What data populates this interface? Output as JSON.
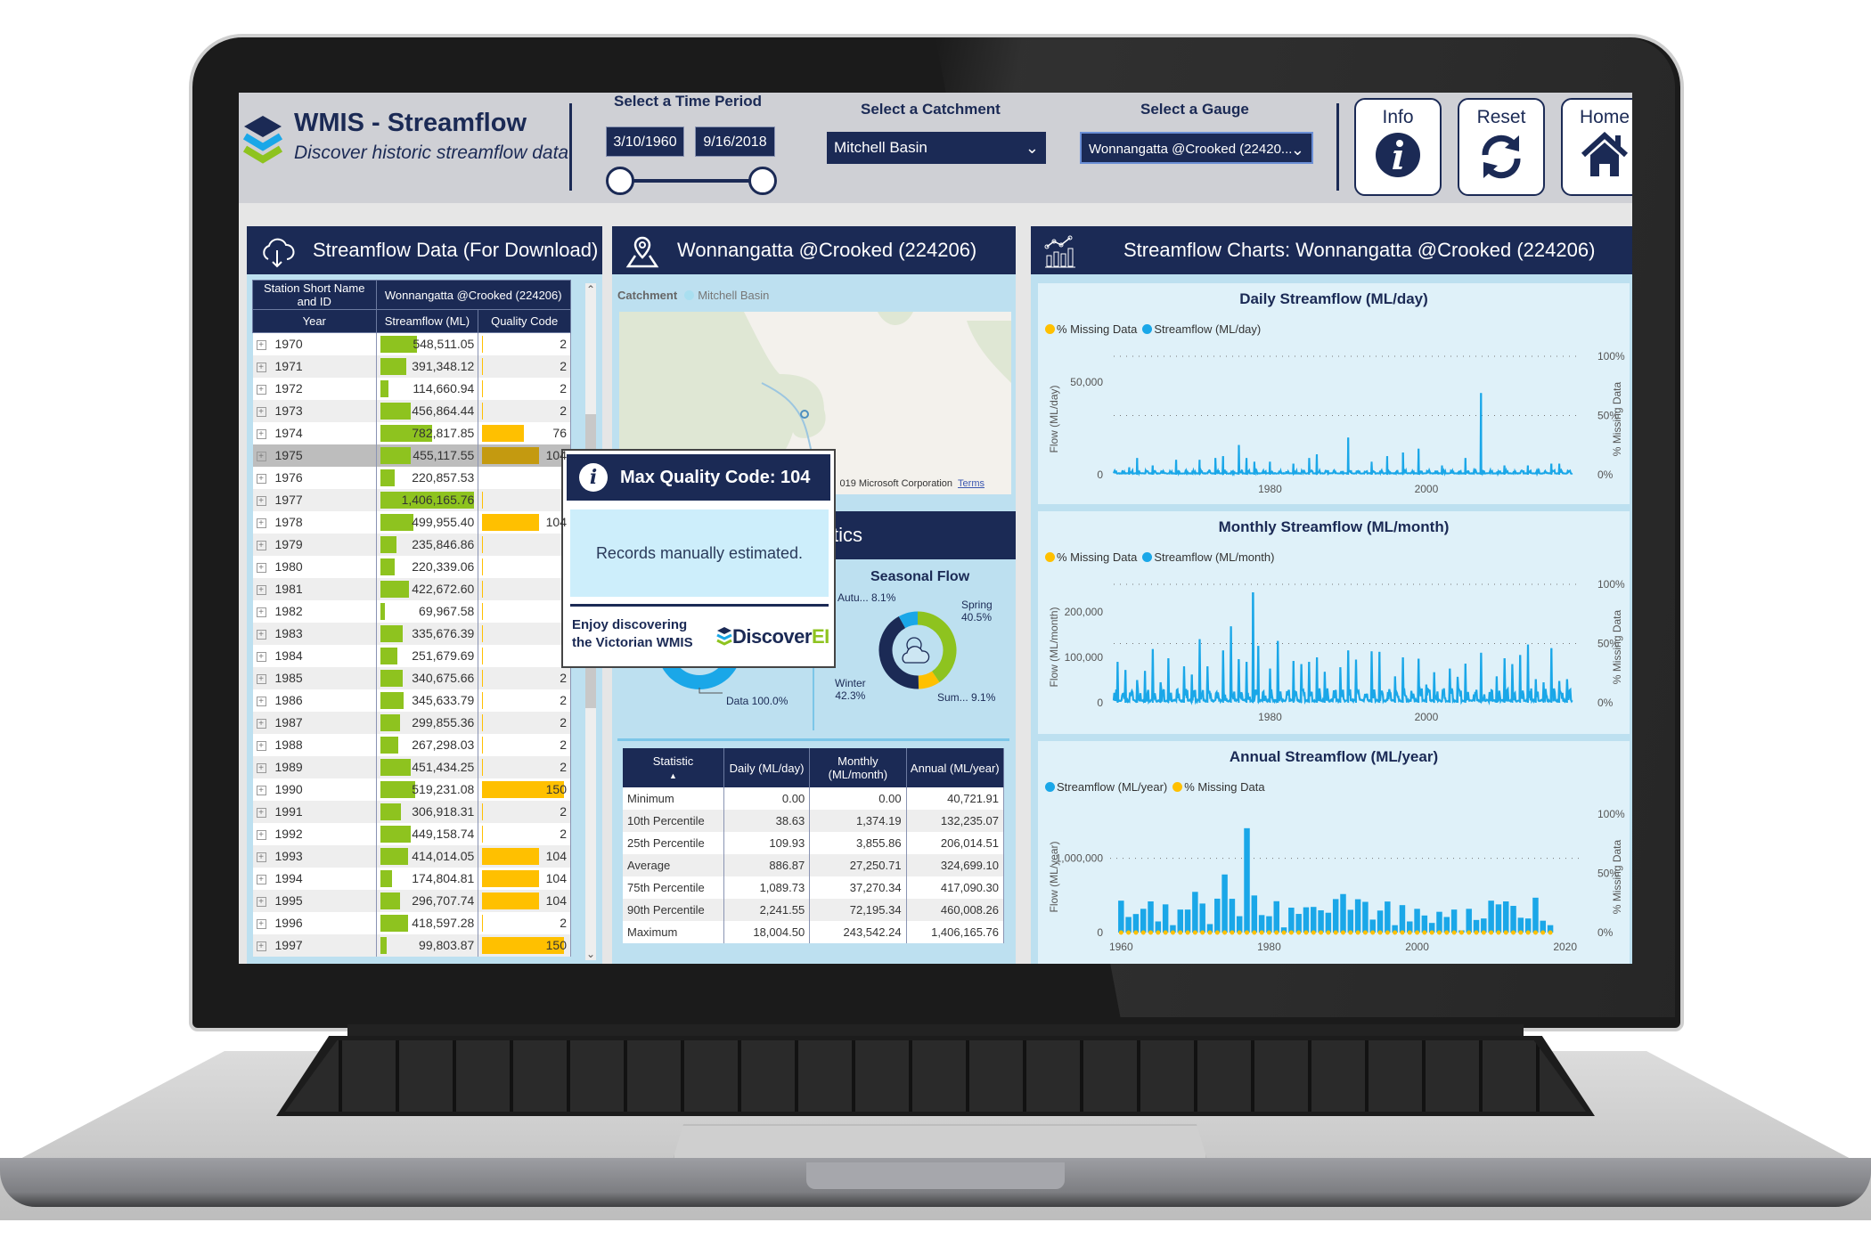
{
  "header": {
    "title": "WMIS - Streamflow",
    "subtitle": "Discover historic streamflow data",
    "time_period_label": "Select a Time Period",
    "start_date": "3/10/1960",
    "end_date": "9/16/2018",
    "catchment_label": "Select  a Catchment",
    "catchment_value": "Mitchell Basin",
    "gauge_label": "Select a Gauge",
    "gauge_value": "Wonnangatta @Crooked (22420...",
    "buttons": {
      "info": "Info",
      "reset": "Reset",
      "home": "Home"
    },
    "icons": {
      "logo": "layers-icon",
      "info": "info-icon",
      "reset": "refresh-icon",
      "home": "home-icon",
      "dropdown": "chevron-down-icon"
    }
  },
  "data_panel": {
    "title": "Streamflow Data (For Download)",
    "icon": "cloud-download-icon",
    "col_station": "Station Short Name and ID",
    "col_station_value": "Wonnangatta @Crooked (224206)",
    "col_year": "Year",
    "col_streamflow": "Streamflow (ML)",
    "col_quality": "Quality Code",
    "rows": [
      {
        "year": "1970",
        "streamflow": "548,511.05",
        "quality": "2",
        "sf": 548511.05,
        "qc": 2
      },
      {
        "year": "1971",
        "streamflow": "391,348.12",
        "quality": "2",
        "sf": 391348.12,
        "qc": 2
      },
      {
        "year": "1972",
        "streamflow": "114,660.94",
        "quality": "2",
        "sf": 114660.94,
        "qc": 2
      },
      {
        "year": "1973",
        "streamflow": "456,864.44",
        "quality": "2",
        "sf": 456864.44,
        "qc": 2
      },
      {
        "year": "1974",
        "streamflow": "782,817.85",
        "quality": "76",
        "sf": 782817.85,
        "qc": 76
      },
      {
        "year": "1975",
        "streamflow": "455,117.55",
        "quality": "104",
        "sf": 455117.55,
        "qc": 104,
        "highlight": true
      },
      {
        "year": "1976",
        "streamflow": "220,857.53",
        "quality": "",
        "sf": 220857.53,
        "qc": 0
      },
      {
        "year": "1977",
        "streamflow": "1,406,165.76",
        "quality": "",
        "sf": 1406165.76,
        "qc": 2
      },
      {
        "year": "1978",
        "streamflow": "499,955.40",
        "quality": "104",
        "sf": 499955.4,
        "qc": 104
      },
      {
        "year": "1979",
        "streamflow": "235,846.86",
        "quality": "",
        "sf": 235846.86,
        "qc": 2
      },
      {
        "year": "1980",
        "streamflow": "220,339.06",
        "quality": "",
        "sf": 220339.06,
        "qc": 2
      },
      {
        "year": "1981",
        "streamflow": "422,672.60",
        "quality": "",
        "sf": 422672.6,
        "qc": 2
      },
      {
        "year": "1982",
        "streamflow": "69,967.58",
        "quality": "",
        "sf": 69967.58,
        "qc": 2
      },
      {
        "year": "1983",
        "streamflow": "335,676.39",
        "quality": "",
        "sf": 335676.39,
        "qc": 2
      },
      {
        "year": "1984",
        "streamflow": "251,679.69",
        "quality": "",
        "sf": 251679.69,
        "qc": 2
      },
      {
        "year": "1985",
        "streamflow": "340,675.66",
        "quality": "2",
        "sf": 340675.66,
        "qc": 2
      },
      {
        "year": "1986",
        "streamflow": "345,633.79",
        "quality": "2",
        "sf": 345633.79,
        "qc": 2
      },
      {
        "year": "1987",
        "streamflow": "299,855.36",
        "quality": "2",
        "sf": 299855.36,
        "qc": 2
      },
      {
        "year": "1988",
        "streamflow": "267,298.03",
        "quality": "2",
        "sf": 267298.03,
        "qc": 2
      },
      {
        "year": "1989",
        "streamflow": "451,434.25",
        "quality": "2",
        "sf": 451434.25,
        "qc": 2
      },
      {
        "year": "1990",
        "streamflow": "519,231.08",
        "quality": "150",
        "sf": 519231.08,
        "qc": 150
      },
      {
        "year": "1991",
        "streamflow": "306,918.31",
        "quality": "2",
        "sf": 306918.31,
        "qc": 2
      },
      {
        "year": "1992",
        "streamflow": "449,158.74",
        "quality": "2",
        "sf": 449158.74,
        "qc": 2
      },
      {
        "year": "1993",
        "streamflow": "414,014.05",
        "quality": "104",
        "sf": 414014.05,
        "qc": 104
      },
      {
        "year": "1994",
        "streamflow": "174,804.81",
        "quality": "104",
        "sf": 174804.81,
        "qc": 104
      },
      {
        "year": "1995",
        "streamflow": "296,707.74",
        "quality": "104",
        "sf": 296707.74,
        "qc": 104
      },
      {
        "year": "1996",
        "streamflow": "418,597.28",
        "quality": "2",
        "sf": 418597.28,
        "qc": 2
      },
      {
        "year": "1997",
        "streamflow": "99,803.87",
        "quality": "150",
        "sf": 99803.87,
        "qc": 150
      }
    ],
    "sf_max": 1406165.76,
    "qc_max": 150
  },
  "map_panel": {
    "title": "Wonnangatta @Crooked (224206)",
    "icon": "map-pin-icon",
    "legend_label": "Catchment",
    "legend_value": "Mitchell Basin",
    "credit": "019 Microsoft Corporation",
    "terms": "Terms"
  },
  "stats_panel": {
    "title_visible": "tics",
    "data_donut_label": "Data 100.0%",
    "seasonal_title": "Seasonal Flow",
    "seasons": [
      {
        "label": "Spring",
        "pct_label": "40.5%",
        "value": 40.5,
        "color": "#8ec31f"
      },
      {
        "label": "Sum...",
        "pct_label": "9.1%",
        "value": 9.1,
        "color": "#ffc000"
      },
      {
        "label": "Winter",
        "pct_label": "42.3%",
        "value": 42.3,
        "color": "#1b2a55"
      },
      {
        "label": "Autu...",
        "pct_label": "8.1%",
        "value": 8.1,
        "color": "#1aa7e8"
      }
    ],
    "table": {
      "headers": [
        "Statistic",
        "Daily (ML/day)",
        "Monthly (ML/month)",
        "Annual (ML/year)"
      ],
      "rows": [
        [
          "Minimum",
          "0.00",
          "0.00",
          "40,721.91"
        ],
        [
          "10th Percentile",
          "38.63",
          "1,374.19",
          "132,235.07"
        ],
        [
          "25th Percentile",
          "109.93",
          "3,855.86",
          "206,014.51"
        ],
        [
          "Average",
          "886.87",
          "27,250.71",
          "324,699.10"
        ],
        [
          "75th Percentile",
          "1,089.73",
          "37,270.34",
          "417,090.30"
        ],
        [
          "90th Percentile",
          "2,241.55",
          "72,195.34",
          "460,008.26"
        ],
        [
          "Maximum",
          "18,004.50",
          "243,542.24",
          "1,406,165.76"
        ]
      ]
    }
  },
  "tooltip": {
    "title": "Max Quality Code: 104",
    "body": "Records manually estimated.",
    "footer_line1": "Enjoy discovering",
    "footer_line2": "the Victorian WMIS",
    "brand_main": "Discover",
    "brand_accent": "EI"
  },
  "charts_panel": {
    "title": "Streamflow Charts: Wonnangatta @Crooked (224206)",
    "icon": "chart-icon",
    "colors": {
      "flow": "#1aa7e8",
      "missing": "#ffc000"
    }
  },
  "chart_data": [
    {
      "type": "line",
      "title": "Daily Streamflow (ML/day)",
      "legend": [
        "% Missing Data",
        "Streamflow (ML/day)"
      ],
      "xlabel": "",
      "ylabel": "Flow (ML/day)",
      "y2label": "% Missing Data",
      "x_ticks": [
        "1980",
        "2000"
      ],
      "y_ticks": [
        "0",
        "50,000"
      ],
      "y2_ticks": [
        "0%",
        "50%",
        "100%"
      ],
      "xlim": [
        1960,
        2018.7
      ],
      "ylim": [
        0,
        60000
      ],
      "peaks": [
        [
          1962,
          4000
        ],
        [
          1963,
          9000
        ],
        [
          1965,
          5000
        ],
        [
          1968,
          8000
        ],
        [
          1971,
          8000
        ],
        [
          1973,
          9000
        ],
        [
          1974,
          10000
        ],
        [
          1976,
          16000
        ],
        [
          1977,
          9000
        ],
        [
          1978,
          7000
        ],
        [
          1980,
          7000
        ],
        [
          1983,
          6000
        ],
        [
          1985,
          9000
        ],
        [
          1986,
          11000
        ],
        [
          1990,
          20000
        ],
        [
          1993,
          7000
        ],
        [
          1995,
          10000
        ],
        [
          1997,
          12000
        ],
        [
          1999,
          14000
        ],
        [
          2002,
          5000
        ],
        [
          2005,
          9000
        ],
        [
          2007,
          44000
        ],
        [
          2010,
          5000
        ],
        [
          2013,
          5000
        ],
        [
          2016,
          6000
        ],
        [
          2017,
          6000
        ]
      ],
      "missing_pct": 0
    },
    {
      "type": "line",
      "title": "Monthly Streamflow (ML/month)",
      "legend": [
        "% Missing Data",
        "Streamflow (ML/month)"
      ],
      "xlabel": "",
      "ylabel": "Flow (ML/month)",
      "y2label": "% Missing Data",
      "x_ticks": [
        "1980",
        "2000"
      ],
      "y_ticks": [
        "0",
        "100,000",
        "200,000"
      ],
      "y2_ticks": [
        "0%",
        "50%",
        "100%"
      ],
      "xlim": [
        1960,
        2018.7
      ],
      "ylim": [
        0,
        245000
      ],
      "peaks": [
        [
          1960.5,
          90000
        ],
        [
          1961.5,
          72000
        ],
        [
          1963,
          50000
        ],
        [
          1964,
          70000
        ],
        [
          1965,
          118000
        ],
        [
          1966,
          45000
        ],
        [
          1967,
          98000
        ],
        [
          1969,
          80000
        ],
        [
          1970,
          62000
        ],
        [
          1971,
          140000
        ],
        [
          1972,
          80000
        ],
        [
          1974,
          115000
        ],
        [
          1975,
          168000
        ],
        [
          1976,
          96000
        ],
        [
          1977,
          90000
        ],
        [
          1977.8,
          243000
        ],
        [
          1978.5,
          125000
        ],
        [
          1980,
          75000
        ],
        [
          1981,
          136000
        ],
        [
          1983,
          92000
        ],
        [
          1984,
          85000
        ],
        [
          1985,
          90000
        ],
        [
          1986,
          100000
        ],
        [
          1987,
          68000
        ],
        [
          1989,
          78000
        ],
        [
          1990,
          115000
        ],
        [
          1991,
          95000
        ],
        [
          1993,
          113000
        ],
        [
          1994,
          112000
        ],
        [
          1996,
          58000
        ],
        [
          1997,
          100000
        ],
        [
          1999,
          97000
        ],
        [
          2000,
          40000
        ],
        [
          2001,
          67000
        ],
        [
          2003,
          75000
        ],
        [
          2004,
          57000
        ],
        [
          2005,
          86000
        ],
        [
          2007,
          110000
        ],
        [
          2009,
          58000
        ],
        [
          2010,
          98000
        ],
        [
          2011,
          85000
        ],
        [
          2012,
          105000
        ],
        [
          2013,
          128000
        ],
        [
          2014,
          52000
        ],
        [
          2015,
          45000
        ],
        [
          2016,
          120000
        ],
        [
          2017,
          48000
        ],
        [
          2018,
          52000
        ]
      ],
      "missing_pct": 0
    },
    {
      "type": "bar",
      "title": "Annual Streamflow (ML/year)",
      "legend": [
        "Streamflow (ML/year)",
        "% Missing Data"
      ],
      "xlabel": "",
      "ylabel": "Flow (ML/year)",
      "y2label": "% Missing Data",
      "x_ticks": [
        "1960",
        "1980",
        "2000",
        "2020"
      ],
      "y_ticks": [
        "0",
        "1,000,000"
      ],
      "y2_ticks": [
        "0%",
        "50%",
        "100%"
      ],
      "xlim": [
        1959,
        2021
      ],
      "ylim": [
        0,
        1500000
      ],
      "categories": [
        1960,
        1961,
        1962,
        1963,
        1964,
        1965,
        1966,
        1967,
        1968,
        1969,
        1970,
        1971,
        1972,
        1973,
        1974,
        1975,
        1976,
        1977,
        1978,
        1979,
        1980,
        1981,
        1982,
        1983,
        1984,
        1985,
        1986,
        1987,
        1988,
        1989,
        1990,
        1991,
        1992,
        1993,
        1994,
        1995,
        1996,
        1997,
        1998,
        1999,
        2000,
        2001,
        2002,
        2003,
        2004,
        2005,
        2006,
        2007,
        2008,
        2009,
        2010,
        2011,
        2012,
        2013,
        2014,
        2015,
        2016,
        2017,
        2018
      ],
      "values": [
        430000,
        210000,
        250000,
        320000,
        420000,
        150000,
        380000,
        100000,
        310000,
        310000,
        548511,
        391348,
        114661,
        456864,
        782818,
        455118,
        220858,
        1406166,
        499955,
        235847,
        220339,
        422673,
        69968,
        335676,
        251680,
        340676,
        345634,
        299855,
        267298,
        451434,
        519231,
        306918,
        449159,
        414014,
        174805,
        296708,
        418597,
        99804,
        370000,
        150000,
        320000,
        230000,
        130000,
        280000,
        210000,
        310000,
        30000,
        320000,
        170000,
        190000,
        430000,
        380000,
        420000,
        360000,
        200000,
        190000,
        470000,
        160000,
        100000
      ],
      "missing_pct": 0
    }
  ]
}
